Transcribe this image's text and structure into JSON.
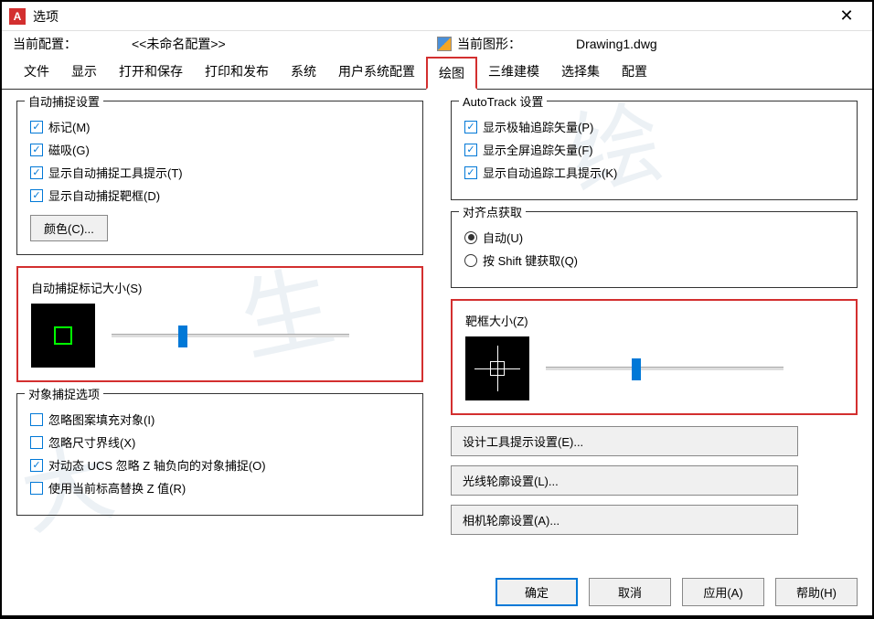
{
  "window": {
    "app_letter": "A",
    "title": "选项"
  },
  "header": {
    "current_config_label": "当前配置：",
    "current_config_value": "<<未命名配置>>",
    "current_drawing_label": "当前图形：",
    "current_drawing_value": "Drawing1.dwg"
  },
  "tabs": [
    {
      "label": "文件"
    },
    {
      "label": "显示"
    },
    {
      "label": "打开和保存"
    },
    {
      "label": "打印和发布"
    },
    {
      "label": "系统"
    },
    {
      "label": "用户系统配置"
    },
    {
      "label": "绘图",
      "active": true
    },
    {
      "label": "三维建模"
    },
    {
      "label": "选择集"
    },
    {
      "label": "配置"
    }
  ],
  "autosnap": {
    "legend": "自动捕捉设置",
    "marker": "标记(M)",
    "magnet": "磁吸(G)",
    "tooltip": "显示自动捕捉工具提示(T)",
    "aperture": "显示自动捕捉靶框(D)",
    "color_btn": "颜色(C)..."
  },
  "marker_size": {
    "label": "自动捕捉标记大小(S)",
    "slider_percent": 30
  },
  "osnap_options": {
    "legend": "对象捕捉选项",
    "ignore_hatch": "忽略图案填充对象(I)",
    "ignore_dim": "忽略尺寸界线(X)",
    "ignore_z": "对动态 UCS 忽略 Z 轴负向的对象捕捉(O)",
    "replace_z": "使用当前标高替换 Z 值(R)"
  },
  "autotrack": {
    "legend": "AutoTrack 设置",
    "polar": "显示极轴追踪矢量(P)",
    "fullscreen": "显示全屏追踪矢量(F)",
    "tooltip": "显示自动追踪工具提示(K)"
  },
  "alignment": {
    "legend": "对齐点获取",
    "auto": "自动(U)",
    "shift": "按 Shift 键获取(Q)"
  },
  "aperture_size": {
    "label": "靶框大小(Z)",
    "slider_percent": 38
  },
  "right_buttons": {
    "drafting_tooltip": "设计工具提示设置(E)...",
    "light_glyph": "光线轮廓设置(L)...",
    "camera_glyph": "相机轮廓设置(A)..."
  },
  "footer": {
    "ok": "确定",
    "cancel": "取消",
    "apply": "应用(A)",
    "help": "帮助(H)"
  }
}
